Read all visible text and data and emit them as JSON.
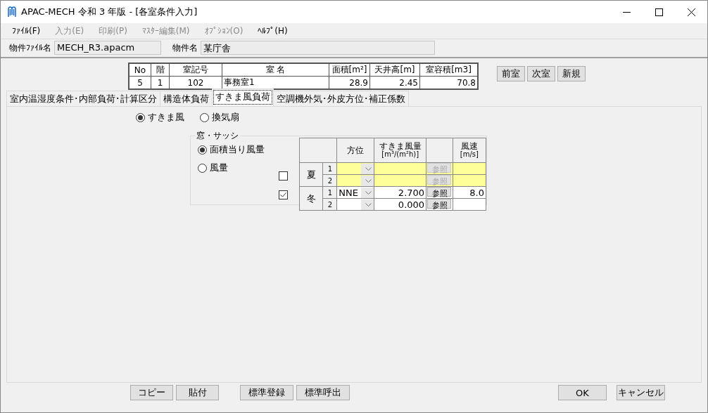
{
  "window": {
    "title": "APAC-MECH 令和 3 年版 - [各室条件入力]"
  },
  "menu": [
    {
      "label": "ﾌｧｲﾙ(F)",
      "disabled": false
    },
    {
      "label": "入力(E)",
      "disabled": true
    },
    {
      "label": "印刷(P)",
      "disabled": true
    },
    {
      "label": "ﾏｽﾀｰ編集(M)",
      "disabled": true
    },
    {
      "label": "ｵﾌﾟｼｮﾝ(O)",
      "disabled": true
    },
    {
      "label": "ﾍﾙﾌﾟ(H)",
      "disabled": false
    }
  ],
  "info_fields": [
    {
      "label": "物件ﾌｧｲﾙ名",
      "value": "MECH_R3.apacm"
    },
    {
      "label": "物件名",
      "value": "某庁舎"
    }
  ],
  "room_table": {
    "columns": [
      "No",
      "階",
      "室記号",
      "室 名",
      "面積[m²]",
      "天井高[m]",
      "室容積[m3]"
    ],
    "rows": [
      [
        "5",
        "1",
        "102",
        "事務室1",
        "28.9",
        "2.45",
        "70.8"
      ]
    ]
  },
  "nav_buttons": [
    "前室",
    "次室",
    "新規"
  ],
  "tabs": [
    {
      "label": "室内温湿度条件･内部負荷･計算区分",
      "selected": false
    },
    {
      "label": "構造体負荷",
      "selected": false
    },
    {
      "label": "すきま風負荷",
      "selected": true
    },
    {
      "label": "空調機外気･外皮方位･補正係数",
      "selected": false
    }
  ],
  "mode_radios": [
    {
      "label": "すきま風",
      "selected": true
    },
    {
      "label": "換気扇",
      "selected": false
    }
  ],
  "window_sash": {
    "title": "窓・サッシ",
    "radios": [
      {
        "label": "面積当り風量",
        "selected": true
      },
      {
        "label": "風量",
        "selected": false
      }
    ],
    "grid_columns": [
      "方位",
      "すきま風量",
      "[m³/(m²h)]",
      "風速",
      "[m/s]"
    ],
    "seasons": [
      {
        "label": "夏",
        "checked": false,
        "rows": [
          {
            "no": "1",
            "ref": "参照"
          },
          {
            "no": "2",
            "ref": "参照"
          }
        ]
      },
      {
        "label": "冬",
        "checked": true,
        "rows": [
          {
            "no": "1",
            "direction": "NNE",
            "flow": "2.700",
            "ref": "参照",
            "speed": "8.0"
          },
          {
            "no": "2",
            "flow": "0.000",
            "ref": "参照"
          }
        ]
      }
    ]
  },
  "left_buttons": [
    "コピー",
    "貼付",
    "標準登録",
    "標準呼出"
  ],
  "right_buttons": [
    "OK",
    "キャンセル"
  ]
}
